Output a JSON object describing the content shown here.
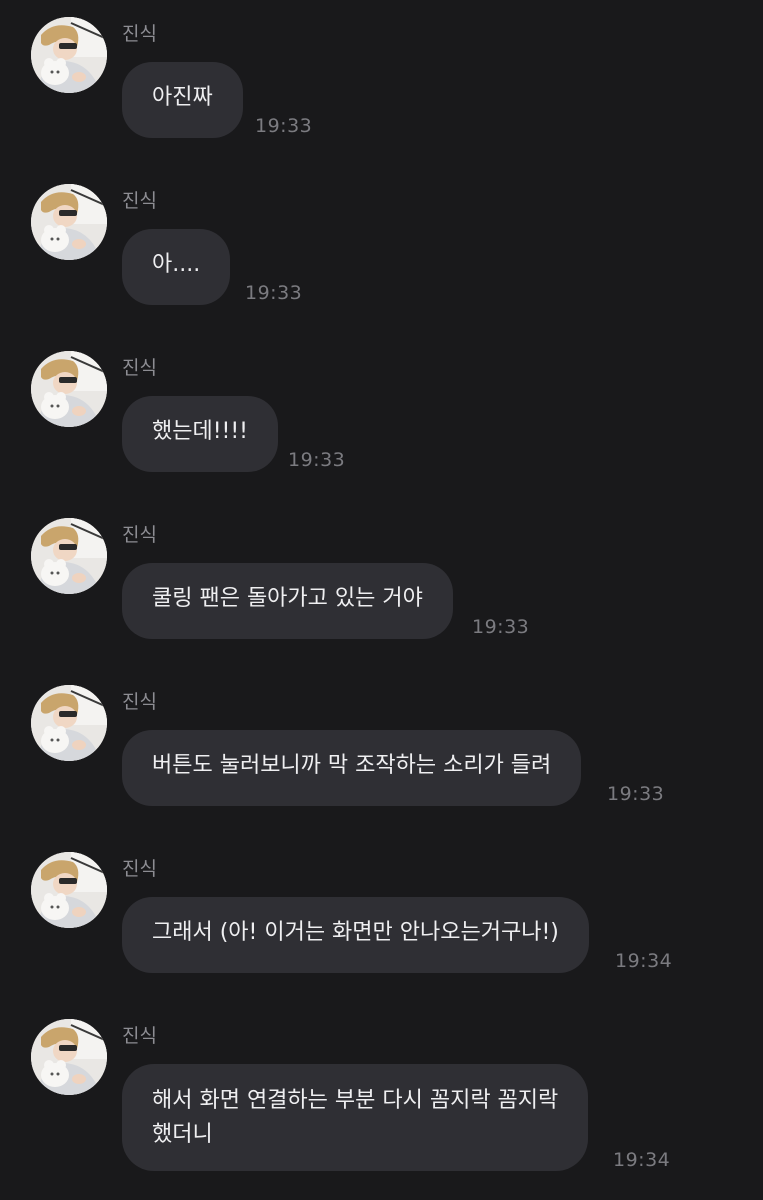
{
  "messages": [
    {
      "sender": "진식",
      "text": "아진짜",
      "time": "19:33",
      "avatar_icon": "profile-photo"
    },
    {
      "sender": "진식",
      "text": "아....",
      "time": "19:33",
      "avatar_icon": "profile-photo"
    },
    {
      "sender": "진식",
      "text": "했는데!!!!",
      "time": "19:33",
      "avatar_icon": "profile-photo"
    },
    {
      "sender": "진식",
      "text": "쿨링 팬은 돌아가고 있는 거야",
      "time": "19:33",
      "avatar_icon": "profile-photo"
    },
    {
      "sender": "진식",
      "text": "버튼도 눌러보니까 막 조작하는 소리가 들려",
      "time": "19:33",
      "avatar_icon": "profile-photo"
    },
    {
      "sender": "진식",
      "text": "그래서 (아! 이거는 화면만 안나오는거구나!)",
      "time": "19:34",
      "avatar_icon": "profile-photo"
    },
    {
      "sender": "진식",
      "text": "해서 화면 연결하는 부분 다시 꼼지락 꼼지락\n했더니",
      "time": "19:34",
      "avatar_icon": "profile-photo"
    }
  ],
  "colors": {
    "background": "#19191b",
    "bubble": "#2f2f34",
    "text": "#efeff1",
    "meta": "#8d8d93"
  }
}
